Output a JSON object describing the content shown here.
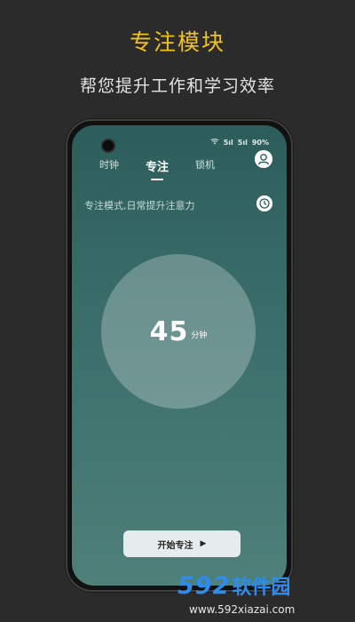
{
  "promo": {
    "title": "专注模块",
    "subtitle": "帮您提升工作和学习效率"
  },
  "status_bar": {
    "icons": [
      "wifi-icon",
      "signal-icon",
      "signal-icon"
    ],
    "signal1": "5ıl",
    "signal2": "5ıl",
    "battery": "90%"
  },
  "tabs": [
    {
      "label": "时钟",
      "active": false
    },
    {
      "label": "专注",
      "active": true
    },
    {
      "label": "锁机",
      "active": false
    }
  ],
  "focus": {
    "hint": "专注模式,日常提升注意力",
    "minutes": "45",
    "unit": "分钟",
    "start_label": "开始专注"
  },
  "watermark": {
    "number": "592",
    "text": "软件园",
    "url": "www.592xiazai.com"
  },
  "colors": {
    "accent_title": "#f2c21b",
    "screen_top": "#2d5d5b",
    "screen_bottom": "#4f807a",
    "watermark_blue": "#2d8cf0"
  }
}
